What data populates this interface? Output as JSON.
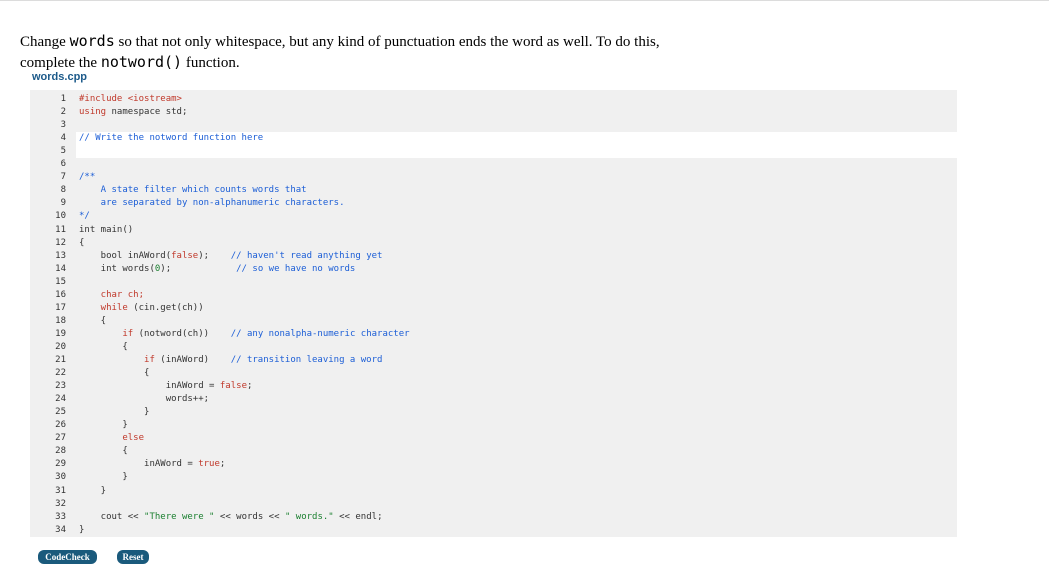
{
  "prompt": {
    "part1": "Change ",
    "code1": "words",
    "part2": " so that not only whitespace, but any kind of punctuation ends the word as well. To do this, complete the ",
    "code2": "notword()",
    "part3": " function."
  },
  "file": {
    "name": "words.cpp"
  },
  "code_lines": [
    {
      "n": "1",
      "segs": [
        {
          "t": "#include <iostream>",
          "c": "p"
        }
      ]
    },
    {
      "n": "2",
      "segs": [
        {
          "t": "using ",
          "c": "k"
        },
        {
          "t": "namespace std;",
          "c": ""
        }
      ]
    },
    {
      "n": "3",
      "segs": []
    },
    {
      "n": "4",
      "segs": [
        {
          "t": "// Write the notword function here",
          "c": "c"
        }
      ]
    },
    {
      "n": "5",
      "segs": []
    },
    {
      "n": "6",
      "segs": []
    },
    {
      "n": "7",
      "segs": [
        {
          "t": "/**",
          "c": "c"
        }
      ]
    },
    {
      "n": "8",
      "segs": [
        {
          "t": "    A state filter which counts words that",
          "c": "c"
        }
      ]
    },
    {
      "n": "9",
      "segs": [
        {
          "t": "    are separated by non-alphanumeric characters.",
          "c": "c"
        }
      ]
    },
    {
      "n": "10",
      "segs": [
        {
          "t": "*/",
          "c": "c"
        }
      ]
    },
    {
      "n": "11",
      "segs": [
        {
          "t": "int main()",
          "c": ""
        }
      ]
    },
    {
      "n": "12",
      "segs": [
        {
          "t": "{",
          "c": ""
        }
      ]
    },
    {
      "n": "13",
      "segs": [
        {
          "t": "    bool inAWord(",
          "c": ""
        },
        {
          "t": "false",
          "c": "k"
        },
        {
          "t": ");    ",
          "c": ""
        },
        {
          "t": "// haven't read anything yet",
          "c": "c"
        }
      ]
    },
    {
      "n": "14",
      "segs": [
        {
          "t": "    int words(",
          "c": ""
        },
        {
          "t": "0",
          "c": "n"
        },
        {
          "t": ");            ",
          "c": ""
        },
        {
          "t": "// so we have no words",
          "c": "c"
        }
      ]
    },
    {
      "n": "15",
      "segs": []
    },
    {
      "n": "16",
      "segs": [
        {
          "t": "    char ch;",
          "c": "k"
        }
      ]
    },
    {
      "n": "17",
      "segs": [
        {
          "t": "    while",
          "c": "k"
        },
        {
          "t": " (cin.get(ch))",
          "c": ""
        }
      ]
    },
    {
      "n": "18",
      "segs": [
        {
          "t": "    {",
          "c": ""
        }
      ]
    },
    {
      "n": "19",
      "segs": [
        {
          "t": "        if",
          "c": "k"
        },
        {
          "t": " (notword(ch))    ",
          "c": ""
        },
        {
          "t": "// any nonalpha-numeric character",
          "c": "c"
        }
      ]
    },
    {
      "n": "20",
      "segs": [
        {
          "t": "        {",
          "c": ""
        }
      ]
    },
    {
      "n": "21",
      "segs": [
        {
          "t": "            if",
          "c": "k"
        },
        {
          "t": " (inAWord)    ",
          "c": ""
        },
        {
          "t": "// transition leaving a word",
          "c": "c"
        }
      ]
    },
    {
      "n": "22",
      "segs": [
        {
          "t": "            {",
          "c": ""
        }
      ]
    },
    {
      "n": "23",
      "segs": [
        {
          "t": "                inAWord = ",
          "c": ""
        },
        {
          "t": "false",
          "c": "k"
        },
        {
          "t": ";",
          "c": ""
        }
      ]
    },
    {
      "n": "24",
      "segs": [
        {
          "t": "                words++;",
          "c": ""
        }
      ]
    },
    {
      "n": "25",
      "segs": [
        {
          "t": "            }",
          "c": ""
        }
      ]
    },
    {
      "n": "26",
      "segs": [
        {
          "t": "        }",
          "c": ""
        }
      ]
    },
    {
      "n": "27",
      "segs": [
        {
          "t": "        else",
          "c": "k"
        }
      ]
    },
    {
      "n": "28",
      "segs": [
        {
          "t": "        {",
          "c": ""
        }
      ]
    },
    {
      "n": "29",
      "segs": [
        {
          "t": "            inAWord = ",
          "c": ""
        },
        {
          "t": "true",
          "c": "k"
        },
        {
          "t": ";",
          "c": ""
        }
      ]
    },
    {
      "n": "30",
      "segs": [
        {
          "t": "        }",
          "c": ""
        }
      ]
    },
    {
      "n": "31",
      "segs": [
        {
          "t": "    }",
          "c": ""
        }
      ]
    },
    {
      "n": "32",
      "segs": []
    },
    {
      "n": "33",
      "segs": [
        {
          "t": "    cout << ",
          "c": ""
        },
        {
          "t": "\"There were \"",
          "c": "n"
        },
        {
          "t": " << words << ",
          "c": ""
        },
        {
          "t": "\" words.\"",
          "c": "n"
        },
        {
          "t": " << endl;",
          "c": ""
        }
      ]
    },
    {
      "n": "34",
      "segs": [
        {
          "t": "}",
          "c": ""
        }
      ]
    }
  ],
  "buttons": {
    "codecheck": "CodeCheck",
    "reset": "Reset"
  }
}
